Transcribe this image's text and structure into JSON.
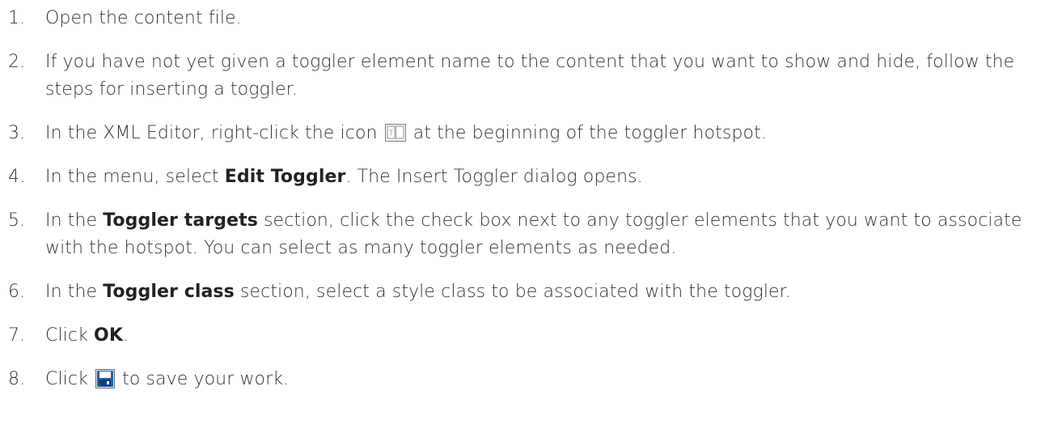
{
  "steps": [
    {
      "num": "1.",
      "text": "Open the content file."
    },
    {
      "num": "2.",
      "text": "If you have not yet given a toggler element name to the content that you want to show and hide, follow the steps for inserting a toggler."
    },
    {
      "num": "3.",
      "pre": "In the XML Editor, right-click the icon",
      "post": "at the beginning of the toggler hotspot.",
      "icon": "toggler-icon"
    },
    {
      "num": "4.",
      "pre": "In the menu, select ",
      "bold": "Edit Toggler",
      "post": ". The Insert Toggler dialog opens."
    },
    {
      "num": "5.",
      "pre": "In the ",
      "bold": "Toggler targets",
      "post": " section, click the check box next to any toggler elements that you want to associate with the hotspot. You can select as many toggler elements as needed."
    },
    {
      "num": "6.",
      "pre": "In the ",
      "bold": "Toggler class",
      "post": " section, select a style class to be associated with the toggler."
    },
    {
      "num": "7.",
      "pre": "Click ",
      "bold": "OK",
      "post": "."
    },
    {
      "num": "8.",
      "pre": "Click",
      "post": "to save your work.",
      "icon": "save-icon"
    }
  ],
  "colors": {
    "text": "#333333",
    "icon_blue": "#1f5fa8"
  }
}
